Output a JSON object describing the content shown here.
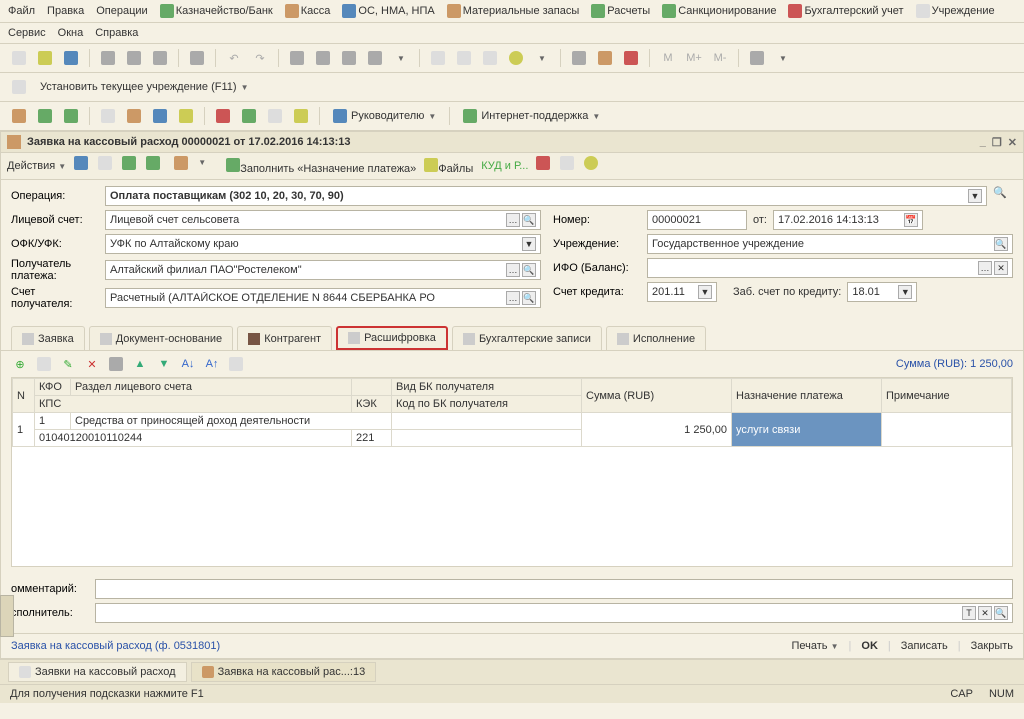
{
  "menu": {
    "file": "Файл",
    "edit": "Правка",
    "ops": "Операции",
    "treasury": "Казначейство/Банк",
    "cash": "Касса",
    "os": "ОС, НМА, НПА",
    "mat": "Материальные запасы",
    "calc": "Расчеты",
    "sanc": "Санкционирование",
    "accounting": "Бухгалтерский учет",
    "inst": "Учреждение",
    "service": "Сервис",
    "windows": "Окна",
    "help": "Справка"
  },
  "tb2": {
    "set_inst": "Установить текущее учреждение (F11)"
  },
  "tb3": {
    "manager": "Руководителю",
    "support": "Интернет-поддержка"
  },
  "doc": {
    "title": "Заявка на кассовый расход 00000021 от 17.02.2016 14:13:13",
    "actions": "Действия",
    "fill": "Заполнить «Назначение платежа»",
    "files": "Файлы",
    "kud": "КУД и Р..."
  },
  "form": {
    "operation_lbl": "Операция:",
    "operation": "Оплата поставщикам (302 10, 20, 30, 70, 90)",
    "ls_lbl": "Лицевой счет:",
    "ls": "Лицевой счет сельсовета",
    "ofk_lbl": "ОФК/УФК:",
    "ofk": "УФК по Алтайскому краю",
    "payee_lbl": "Получатель платежа:",
    "payee": "Алтайский филиал ПАО\"Ростелеком\"",
    "acc_lbl": "Счет получателя:",
    "acc": "Расчетный (АЛТАЙСКОЕ ОТДЕЛЕНИЕ N 8644 СБЕРБАНКА РО",
    "num_lbl": "Номер:",
    "num": "00000021",
    "from": "от:",
    "date": "17.02.2016 14:13:13",
    "inst_lbl": "Учреждение:",
    "inst": "Государственное учреждение",
    "ifo_lbl": "ИФО (Баланс):",
    "ifo": "",
    "credit_lbl": "Счет кредита:",
    "credit": "201.11",
    "zab_lbl": "Заб. счет по кредиту:",
    "zab": "18.01"
  },
  "tabs": {
    "t1": "Заявка",
    "t2": "Документ-основание",
    "t3": "Контрагент",
    "t4": "Расшифровка",
    "t5": "Бухгалтерские записи",
    "t6": "Исполнение"
  },
  "grid": {
    "sum_lbl": "Сумма (RUB): 1 250,00",
    "h_n": "N",
    "h_kfo": "КФО",
    "h_section": "Раздел лицевого счета",
    "h_bk": "Вид БК получателя",
    "h_sum": "Сумма (RUB)",
    "h_purpose": "Назначение платежа",
    "h_note": "Примечание",
    "h_kps": "КПС",
    "h_kek": "КЭК",
    "h_bk_code": "Код по БК получателя",
    "r1_n": "1",
    "r1_kfo": "1",
    "r1_section": "Средства от приносящей доход деятельности",
    "r1_sum": "1 250,00",
    "r1_purpose": "услуги связи",
    "r2_kps": "01040120010110244",
    "r2_kek": "221"
  },
  "bottom": {
    "comment_lbl": "омментарий:",
    "exec_lbl": "сполнитель:"
  },
  "footer": {
    "forminfo": "Заявка на кассовый расход (ф. 0531801)",
    "print": "Печать",
    "ok": "OK",
    "save": "Записать",
    "close": "Закрыть"
  },
  "wintabs": {
    "w1": "Заявки на кассовый расход",
    "w2": "Заявка на кассовый рас...:13"
  },
  "status": {
    "hint": "Для получения подсказки нажмите F1",
    "cap": "CAP",
    "num": "NUM"
  }
}
